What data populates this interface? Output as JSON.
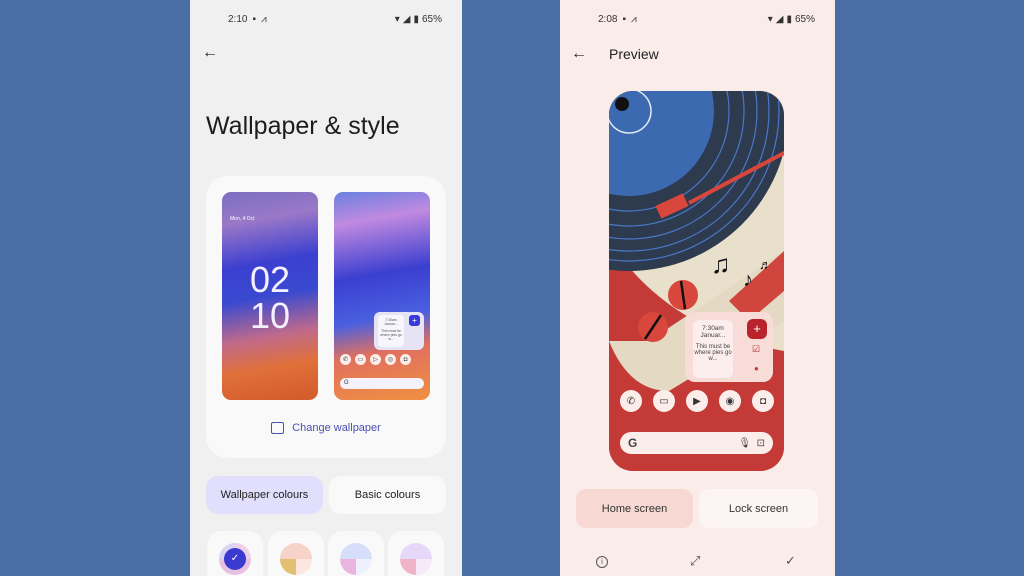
{
  "left": {
    "status": {
      "time": "2:10",
      "battery": "65%"
    },
    "title": "Wallpaper & style",
    "lock_preview": {
      "date": "Mon, 4 Oct",
      "hour": "02",
      "minute": "10"
    },
    "home_preview": {
      "widget_time": "7:30am",
      "widget_date": "Januar...",
      "widget_note": "This must be where pies go w..."
    },
    "change_wallpaper": "Change wallpaper",
    "tabs": [
      {
        "label": "Wallpaper colours",
        "selected": true
      },
      {
        "label": "Basic colours",
        "selected": false
      }
    ],
    "swatches": [
      {
        "colors": [
          "#3a3ad0",
          "#e8c0e0",
          "#f0d0e8"
        ],
        "selected": true
      },
      {
        "colors": [
          "#f6d2c8",
          "#e2c070",
          "#fbe7df"
        ],
        "selected": false
      },
      {
        "colors": [
          "#d6defa",
          "#e9b4e0",
          "#eef0fc"
        ],
        "selected": false
      },
      {
        "colors": [
          "#e6d8f8",
          "#f0b4c8",
          "#f6eaf8"
        ],
        "selected": false
      }
    ],
    "accent": "#4a4fb0"
  },
  "right": {
    "status": {
      "time": "2:08",
      "battery": "65%"
    },
    "title": "Preview",
    "widget": {
      "time": "7:30am",
      "date": "Januar...",
      "note": "This must be where pies go w..."
    },
    "buttons": [
      {
        "label": "Home screen",
        "selected": true
      },
      {
        "label": "Lock screen",
        "selected": false
      }
    ],
    "bottom_icons": [
      "info-icon",
      "fullscreen-icon",
      "check-icon"
    ],
    "accent": "#b8242c"
  }
}
